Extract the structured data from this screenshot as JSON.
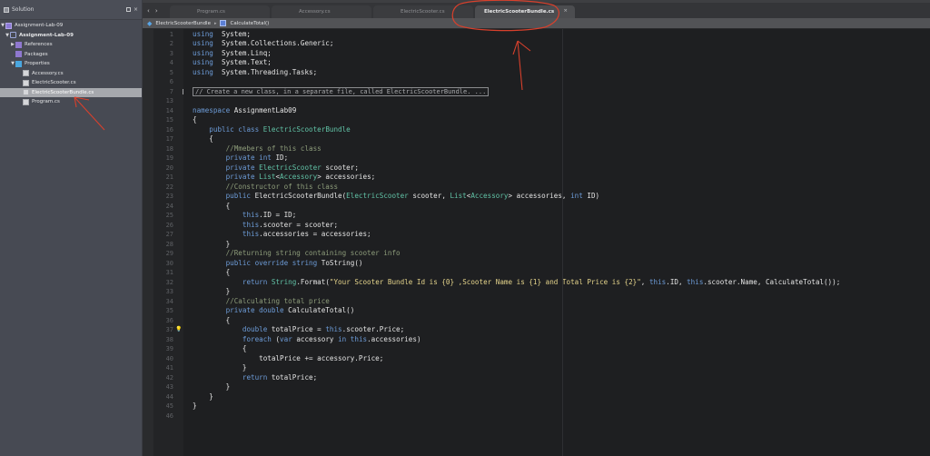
{
  "sidebar": {
    "title": "Solution",
    "items": [
      {
        "label": "Assignment-Lab-09",
        "type": "solution",
        "expanded": true
      },
      {
        "label": "Assignment-Lab-09",
        "type": "project",
        "expanded": true
      },
      {
        "label": "References",
        "type": "folder",
        "expanded": false
      },
      {
        "label": "Packages",
        "type": "folder"
      },
      {
        "label": "Properties",
        "type": "folder",
        "expanded": true
      },
      {
        "label": "Accessory.cs",
        "type": "file"
      },
      {
        "label": "ElectricScooter.cs",
        "type": "file"
      },
      {
        "label": "ElectricScooterBundle.cs",
        "type": "file",
        "selected": true
      },
      {
        "label": "Program.cs",
        "type": "file"
      }
    ]
  },
  "tabs": [
    {
      "label": "Program.cs",
      "active": false
    },
    {
      "label": "Accessory.cs",
      "active": false
    },
    {
      "label": "ElectricScooter.cs",
      "active": false
    },
    {
      "label": "ElectricScooterBundle.cs",
      "active": true,
      "close": "×"
    }
  ],
  "nav": {
    "back": "‹",
    "forward": "›"
  },
  "breadcrumb": {
    "class_name": "ElectricScooterBundle",
    "separator": "▸",
    "method": "CalculateTotal()"
  },
  "editor": {
    "lines": [
      {
        "n": "1",
        "segs": [
          [
            "kw",
            "using"
          ],
          [
            "",
            "  System;"
          ]
        ]
      },
      {
        "n": "2",
        "segs": [
          [
            "kw",
            "using"
          ],
          [
            "",
            "  System.Collections.Generic;"
          ]
        ]
      },
      {
        "n": "3",
        "segs": [
          [
            "kw",
            "using"
          ],
          [
            "",
            "  System.Linq;"
          ]
        ]
      },
      {
        "n": "4",
        "segs": [
          [
            "kw",
            "using"
          ],
          [
            "",
            "  System.Text;"
          ]
        ]
      },
      {
        "n": "5",
        "segs": [
          [
            "kw",
            "using"
          ],
          [
            "",
            "  System.Threading.Tasks;"
          ]
        ]
      },
      {
        "n": "6",
        "segs": []
      },
      {
        "n": "7",
        "fold": "// Create a new class, in a separate file, called ElectricScooterBundle. ..."
      },
      {
        "n": "13",
        "segs": []
      },
      {
        "n": "14",
        "segs": [
          [
            "kw",
            "namespace"
          ],
          [
            "",
            " AssignmentLab09"
          ]
        ]
      },
      {
        "n": "15",
        "segs": [
          [
            "",
            "{"
          ]
        ]
      },
      {
        "n": "16",
        "segs": [
          [
            "",
            "    "
          ],
          [
            "kw",
            "public class"
          ],
          [
            "",
            " "
          ],
          [
            "ty",
            "ElectricScooterBundle"
          ]
        ]
      },
      {
        "n": "17",
        "segs": [
          [
            "",
            "    {"
          ]
        ]
      },
      {
        "n": "18",
        "segs": [
          [
            "",
            "        "
          ],
          [
            "cm",
            "//Mmebers of this class"
          ]
        ]
      },
      {
        "n": "19",
        "segs": [
          [
            "",
            "        "
          ],
          [
            "kw",
            "private int"
          ],
          [
            "",
            " ID;"
          ]
        ]
      },
      {
        "n": "20",
        "segs": [
          [
            "",
            "        "
          ],
          [
            "kw",
            "private"
          ],
          [
            "",
            " "
          ],
          [
            "ty",
            "ElectricScooter"
          ],
          [
            "",
            " scooter;"
          ]
        ]
      },
      {
        "n": "21",
        "segs": [
          [
            "",
            "        "
          ],
          [
            "kw",
            "private"
          ],
          [
            "",
            " "
          ],
          [
            "ty",
            "List"
          ],
          [
            "",
            "<"
          ],
          [
            "ty",
            "Accessory"
          ],
          [
            "",
            "> accessories;"
          ]
        ]
      },
      {
        "n": "22",
        "segs": [
          [
            "",
            "        "
          ],
          [
            "cm",
            "//Constructor of this class"
          ]
        ]
      },
      {
        "n": "23",
        "segs": [
          [
            "",
            "        "
          ],
          [
            "kw",
            "public"
          ],
          [
            "",
            " ElectricScooterBundle("
          ],
          [
            "ty",
            "ElectricScooter"
          ],
          [
            "",
            " scooter, "
          ],
          [
            "ty",
            "List"
          ],
          [
            "",
            "<"
          ],
          [
            "ty",
            "Accessory"
          ],
          [
            "",
            "> accessories, "
          ],
          [
            "kw",
            "int"
          ],
          [
            "",
            " ID)"
          ]
        ]
      },
      {
        "n": "24",
        "segs": [
          [
            "",
            "        {"
          ]
        ]
      },
      {
        "n": "25",
        "segs": [
          [
            "",
            "            "
          ],
          [
            "kw",
            "this"
          ],
          [
            "",
            ".ID = ID;"
          ]
        ]
      },
      {
        "n": "26",
        "segs": [
          [
            "",
            "            "
          ],
          [
            "kw",
            "this"
          ],
          [
            "",
            ".scooter = scooter;"
          ]
        ]
      },
      {
        "n": "27",
        "segs": [
          [
            "",
            "            "
          ],
          [
            "kw",
            "this"
          ],
          [
            "",
            ".accessories = accessories;"
          ]
        ]
      },
      {
        "n": "28",
        "segs": [
          [
            "",
            "        }"
          ]
        ]
      },
      {
        "n": "29",
        "segs": [
          [
            "",
            "        "
          ],
          [
            "cm",
            "//Returning string containing scooter info"
          ]
        ]
      },
      {
        "n": "30",
        "segs": [
          [
            "",
            "        "
          ],
          [
            "kw",
            "public override string"
          ],
          [
            "",
            " ToString()"
          ]
        ]
      },
      {
        "n": "31",
        "segs": [
          [
            "",
            "        {"
          ]
        ]
      },
      {
        "n": "32",
        "segs": [
          [
            "",
            "            "
          ],
          [
            "kw",
            "return"
          ],
          [
            "",
            " "
          ],
          [
            "ty",
            "String"
          ],
          [
            "",
            ".Format("
          ],
          [
            "st",
            "\"Your Scooter Bundle Id is {0} ,Scooter Name is {1} and Total Price is {2}\""
          ],
          [
            "",
            ", "
          ],
          [
            "kw",
            "this"
          ],
          [
            "",
            ".ID, "
          ],
          [
            "kw",
            "this"
          ],
          [
            "",
            ".scooter.Name, CalculateTotal());"
          ]
        ]
      },
      {
        "n": "33",
        "segs": [
          [
            "",
            "        }"
          ]
        ]
      },
      {
        "n": "34",
        "segs": [
          [
            "",
            "        "
          ],
          [
            "cm",
            "//Calculating total price"
          ]
        ]
      },
      {
        "n": "35",
        "segs": [
          [
            "",
            "        "
          ],
          [
            "kw",
            "private double"
          ],
          [
            "",
            " CalculateTotal()"
          ]
        ]
      },
      {
        "n": "36",
        "segs": [
          [
            "",
            "        {"
          ]
        ]
      },
      {
        "n": "37",
        "bulb": true,
        "segs": [
          [
            "",
            "            "
          ],
          [
            "kw",
            "double"
          ],
          [
            "",
            " totalPrice = "
          ],
          [
            "kw",
            "this"
          ],
          [
            "",
            ".scooter.Price;"
          ]
        ]
      },
      {
        "n": "38",
        "segs": [
          [
            "",
            "            "
          ],
          [
            "kw",
            "foreach"
          ],
          [
            "",
            " ("
          ],
          [
            "kw",
            "var"
          ],
          [
            "",
            " accessory "
          ],
          [
            "kw",
            "in"
          ],
          [
            "",
            " "
          ],
          [
            "kw",
            "this"
          ],
          [
            "",
            ".accessories)"
          ]
        ]
      },
      {
        "n": "39",
        "segs": [
          [
            "",
            "            {"
          ]
        ]
      },
      {
        "n": "40",
        "segs": [
          [
            "",
            "                totalPrice += accessory.Price;"
          ]
        ]
      },
      {
        "n": "41",
        "segs": [
          [
            "",
            "            }"
          ]
        ]
      },
      {
        "n": "42",
        "segs": [
          [
            "",
            "            "
          ],
          [
            "kw",
            "return"
          ],
          [
            "",
            " totalPrice;"
          ]
        ]
      },
      {
        "n": "43",
        "segs": [
          [
            "",
            "        }"
          ]
        ]
      },
      {
        "n": "44",
        "segs": [
          [
            "",
            "    }"
          ]
        ]
      },
      {
        "n": "45",
        "segs": [
          [
            "",
            "}"
          ]
        ]
      },
      {
        "n": "46",
        "segs": []
      }
    ]
  },
  "annotation_color": "#d8402c"
}
